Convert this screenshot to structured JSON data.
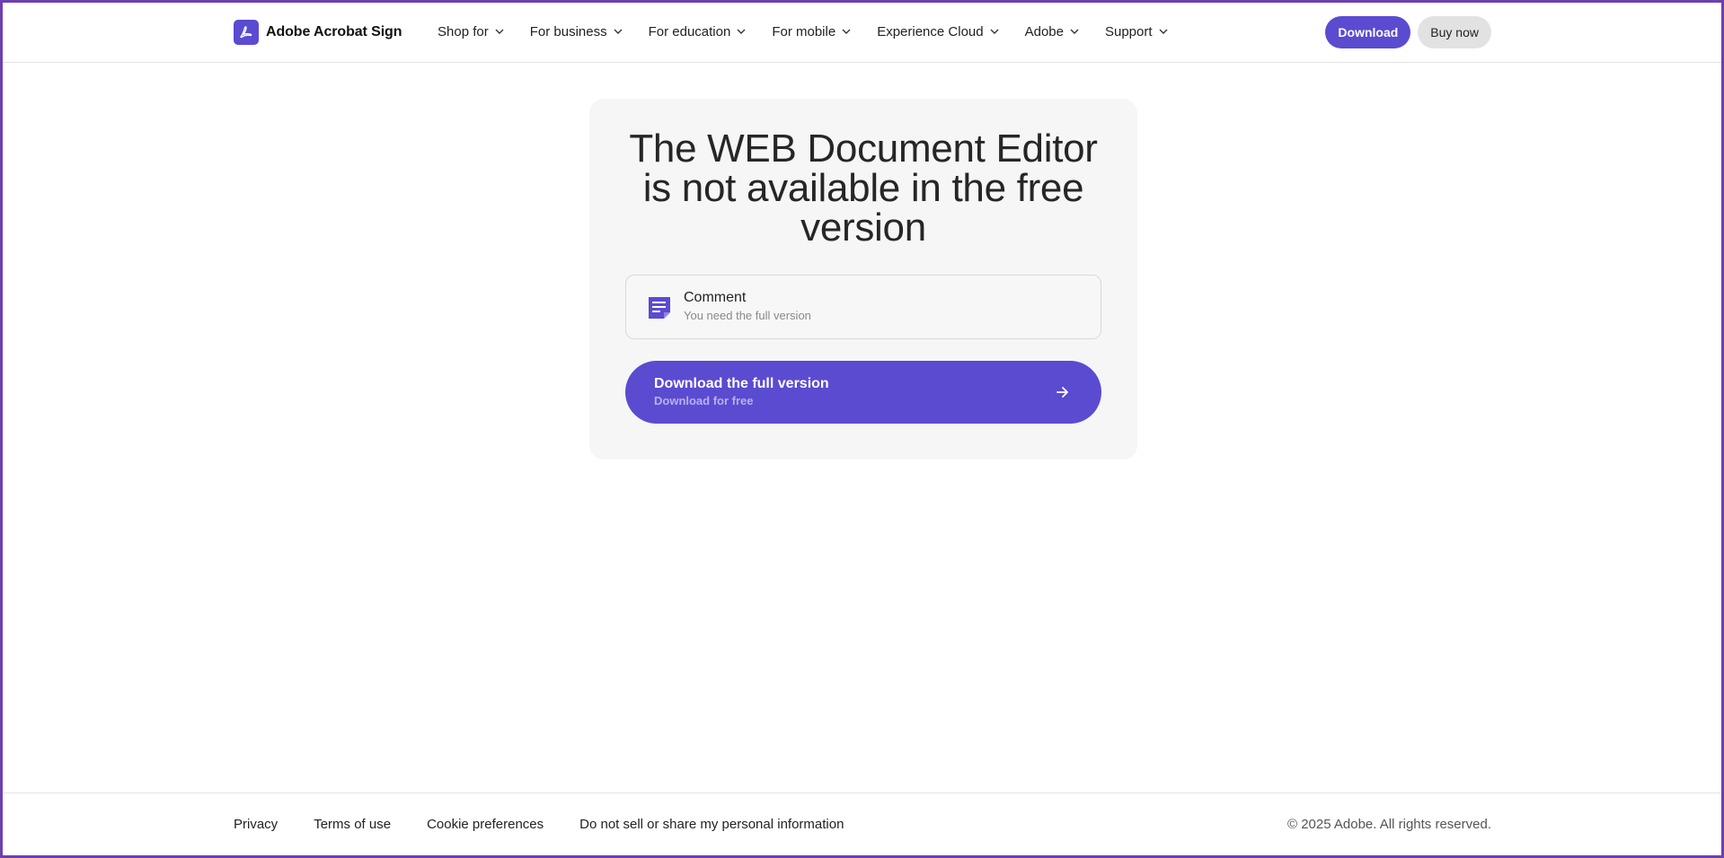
{
  "header": {
    "brand": "Adobe Acrobat Sign",
    "nav": [
      {
        "label": "Shop for"
      },
      {
        "label": "For business"
      },
      {
        "label": "For education"
      },
      {
        "label": "For mobile"
      },
      {
        "label": "Experience Cloud"
      },
      {
        "label": "Adobe"
      },
      {
        "label": "Support"
      }
    ],
    "download_label": "Download",
    "buy_label": "Buy now"
  },
  "main": {
    "title": "The WEB Document Editor is not available in the free version",
    "feature": {
      "name": "Comment",
      "note": "You need the full version",
      "icon": "comment-note-icon"
    },
    "cta": {
      "title": "Download the full version",
      "subtitle": "Download for free"
    }
  },
  "footer": {
    "links": [
      {
        "label": "Privacy"
      },
      {
        "label": "Terms of use"
      },
      {
        "label": "Cookie preferences"
      },
      {
        "label": "Do not sell or share my personal information"
      }
    ],
    "copyright": "© 2025 Adobe. All rights reserved."
  },
  "colors": {
    "accent": "#5a4bd1",
    "frame": "#6d3fb0",
    "card_bg": "#f6f6f6"
  }
}
